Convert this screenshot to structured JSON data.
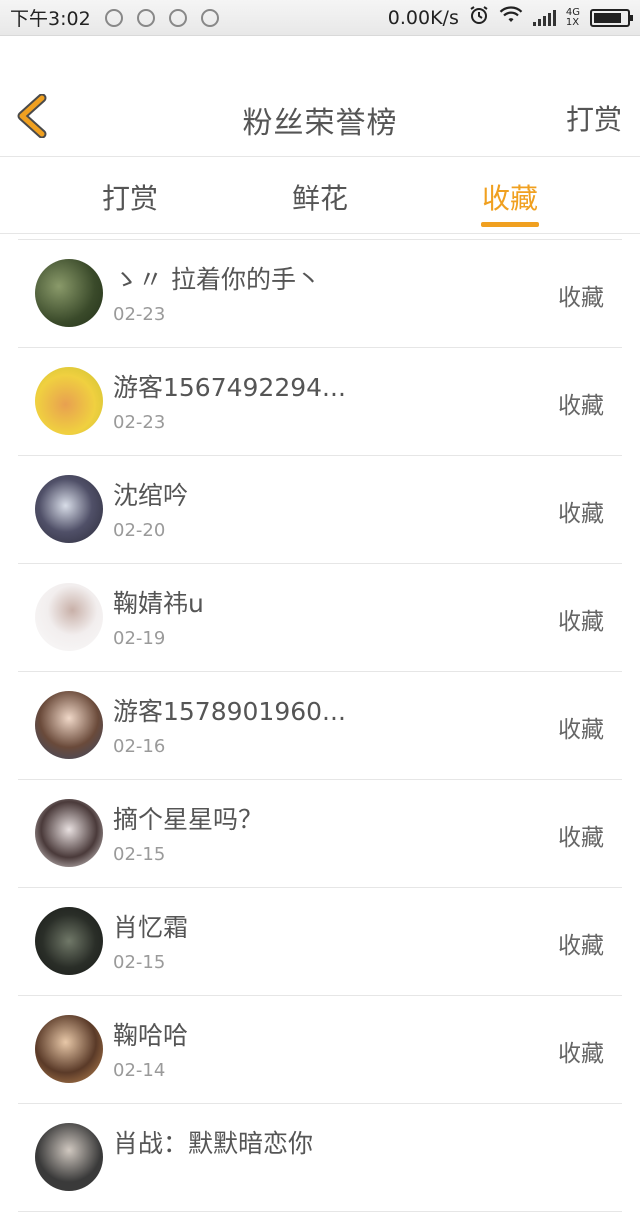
{
  "status_bar": {
    "time": "下午3:02",
    "net_speed": "0.00K/s",
    "network_type_top": "4G",
    "network_type_bottom": "1X",
    "battery_level": 0.85
  },
  "header": {
    "title": "粉丝荣誉榜",
    "action": "打赏"
  },
  "tabs": [
    {
      "label": "打赏",
      "active": false
    },
    {
      "label": "鲜花",
      "active": false
    },
    {
      "label": "收藏",
      "active": true
    }
  ],
  "colors": {
    "accent": "#f0a020",
    "text": "#555555",
    "subtext": "#9a9a9a",
    "divider": "#e6e6e6"
  },
  "items": [
    {
      "name": "ゝ〃 拉着你的手丶",
      "date": "02-23",
      "action": "收藏"
    },
    {
      "name": "游客1567492294...",
      "date": "02-23",
      "action": "收藏"
    },
    {
      "name": "沈绾吟",
      "date": "02-20",
      "action": "收藏"
    },
    {
      "name": "鞠婧祎u",
      "date": "02-19",
      "action": "收藏"
    },
    {
      "name": "游客1578901960...",
      "date": "02-16",
      "action": "收藏"
    },
    {
      "name": "摘个星星吗？",
      "date": "02-15",
      "action": "收藏"
    },
    {
      "name": "肖忆霜",
      "date": "02-15",
      "action": "收藏"
    },
    {
      "name": "鞠哈哈",
      "date": "02-14",
      "action": "收藏"
    },
    {
      "name": "肖战：默默暗恋你",
      "date": "",
      "action": ""
    }
  ]
}
